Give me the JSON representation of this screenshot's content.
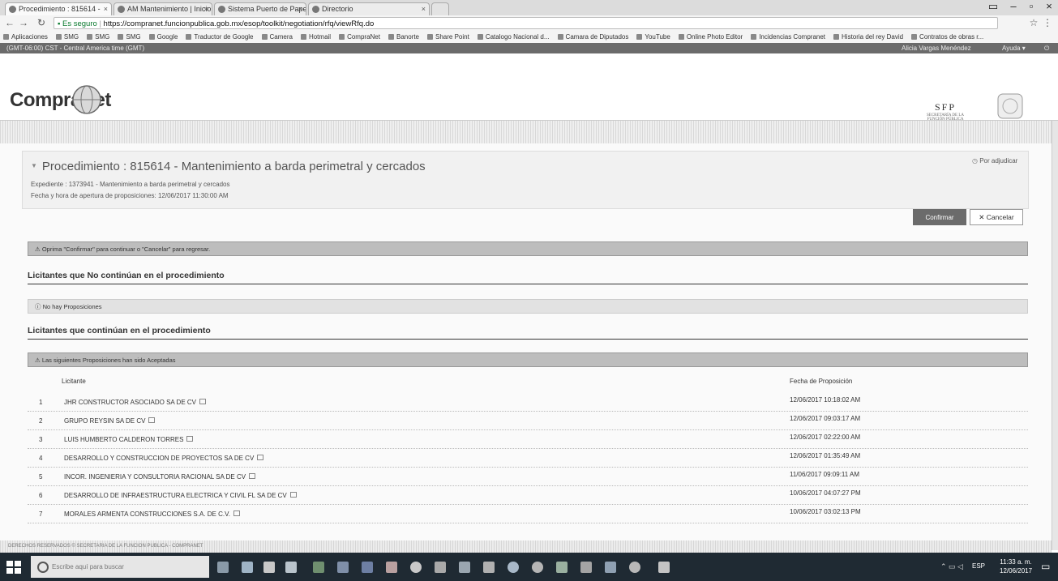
{
  "browser": {
    "tabs": [
      {
        "label": "Procedimiento : 815614 -"
      },
      {
        "label": "AM Mantenimiento | Inicio"
      },
      {
        "label": "Sistema Puerto de Papel"
      },
      {
        "label": "Directorio"
      }
    ],
    "address": {
      "secure_label": "Es seguro",
      "url": "https://compranet.funcionpublica.gob.mx/esop/toolkit/negotiation/rfq/viewRfq.do"
    },
    "bookmarks": [
      "Aplicaciones",
      "SMG",
      "SMG",
      "SMG",
      "Google",
      "Traductor de Google",
      "Camera",
      "Hotmail",
      "CompraNet",
      "Banorte",
      "Share Point",
      "Catalogo Nacional d...",
      "Camara de Diputados",
      "YouTube",
      "Online Photo Editor",
      "Incidencias Compranet",
      "Historia del rey David",
      "Contratos de obras r..."
    ]
  },
  "site": {
    "timezone": "(GMT-06:00) CST - Central America time (GMT)",
    "user": "Alicia Vargas Menéndez",
    "help": "Ayuda",
    "logo": "CompraNet",
    "agency_logo": "SFP",
    "agency_subtitle": "SECRETARÍA DE LA FUNCIÓN PÚBLICA"
  },
  "procedure": {
    "title": "Procedimiento : 815614 - Mantenimiento a barda perimetral y cercados",
    "expediente": "Expediente : 1373941 - Mantenimiento a barda perimetral y cercados",
    "fecha": "Fecha y hora de apertura de proposiciones: 12/06/2017 11:30:00 AM",
    "status": "Por adjudicar"
  },
  "actions": {
    "confirm": "Confirmar",
    "cancel": "Cancelar"
  },
  "messages": {
    "instruction": "Oprima \"Confirmar\" para continuar o \"Cancelar\" para regresar.",
    "no_propuestas": "No hay Proposiciones",
    "aceptadas": "Las siguientes Proposiciones han sido Aceptadas"
  },
  "sections": {
    "no_continuan": "Licitantes que No continúan en el procedimiento",
    "continuan": "Licitantes que continúan en el procedimiento"
  },
  "table": {
    "headers": {
      "licitante": "Licitante",
      "fecha": "Fecha de Proposición"
    },
    "rows": [
      {
        "num": "1",
        "name": "JHR CONSTRUCTOR ASOCIADO SA DE CV",
        "date": "12/06/2017 10:18:02 AM"
      },
      {
        "num": "2",
        "name": "GRUPO REYSIN SA DE CV",
        "date": "12/06/2017 09:03:17 AM"
      },
      {
        "num": "3",
        "name": "LUIS HUMBERTO CALDERON TORRES",
        "date": "12/06/2017 02:22:00 AM"
      },
      {
        "num": "4",
        "name": "DESARROLLO Y CONSTRUCCION DE PROYECTOS SA DE CV",
        "date": "12/06/2017 01:35:49 AM"
      },
      {
        "num": "5",
        "name": "INCOR. INGENIERIA Y CONSULTORIA RACIONAL SA DE CV",
        "date": "11/06/2017 09:09:11 AM"
      },
      {
        "num": "6",
        "name": "DESARROLLO DE INFRAESTRUCTURA ELECTRICA Y CIVIL FL SA DE CV",
        "date": "10/06/2017 04:07:27 PM"
      },
      {
        "num": "7",
        "name": "MORALES ARMENTA CONSTRUCCIONES S.A. DE C.V.",
        "date": "10/06/2017 03:02:13 PM"
      }
    ]
  },
  "footer": {
    "text": "DERECHOS RESERVADOS © SECRETARIA DE LA FUNCION PUBLICA - COMPRANET"
  },
  "taskbar": {
    "search_placeholder": "Escribe aquí para buscar",
    "lang": "ESP",
    "time": "11:33 a. m.",
    "date": "12/06/2017"
  }
}
